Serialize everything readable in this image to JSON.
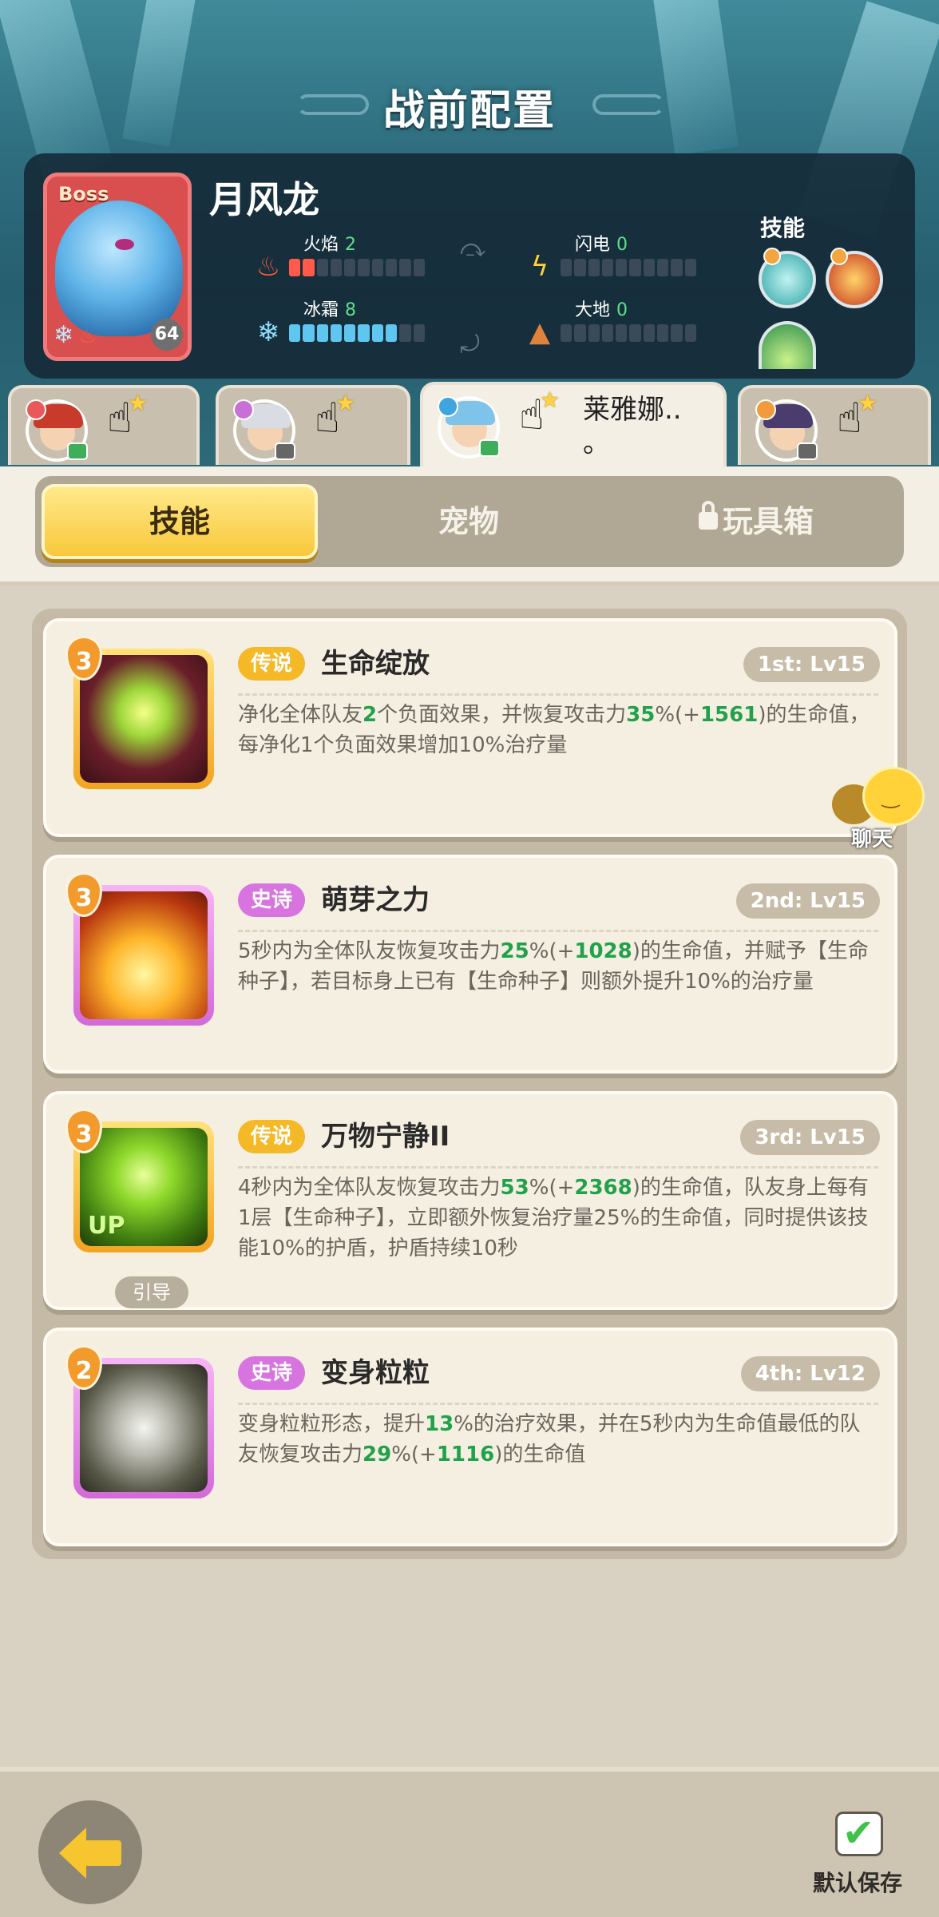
{
  "header": {
    "title": "战前配置"
  },
  "boss": {
    "tag": "Boss",
    "name": "月风龙",
    "level": "64",
    "stats": {
      "fire": {
        "label": "火焰",
        "value": "2",
        "level": 2,
        "max": 10
      },
      "lightning": {
        "label": "闪电",
        "value": "0",
        "level": 0,
        "max": 10
      },
      "frost": {
        "label": "冰霜",
        "value": "8",
        "level": 8,
        "max": 10
      },
      "earth": {
        "label": "大地",
        "value": "0",
        "level": 0,
        "max": 10
      }
    },
    "skills_label": "技能",
    "skill_icons": [
      "wind-vortex-icon",
      "fire-orb-icon",
      "green-leaf-icon"
    ]
  },
  "heroes": [
    {
      "name": "",
      "active": false,
      "hair_color": "#c83a2a",
      "element_color": "#e85a5a",
      "device_color": "#3fae5a"
    },
    {
      "name": "",
      "active": false,
      "hair_color": "#d9dde3",
      "element_color": "#c970d6",
      "device_color": "#666666"
    },
    {
      "name": "莱雅娜..\n。",
      "active": true,
      "hair_color": "#7ec3ea",
      "element_color": "#3ea5e0",
      "device_color": "#3fae5a"
    },
    {
      "name": "",
      "active": false,
      "hair_color": "#4b3c6e",
      "element_color": "#f39a3a",
      "device_color": "#666666"
    }
  ],
  "category_tabs": {
    "skills": "技能",
    "pets": "宠物",
    "toybox": "玩具箱",
    "active": "skills"
  },
  "skills": [
    {
      "rarity": "传说",
      "rarity_class": "legend",
      "name": "生命绽放",
      "slot": "1st: Lv15",
      "stars": "3",
      "desc_parts": [
        "净化全体队友",
        "2",
        "个负面效果，并恢复攻击力",
        "35",
        "%(+",
        "1561",
        ")的生命值，每净化1个负面效果增加10%治疗量"
      ]
    },
    {
      "rarity": "史诗",
      "rarity_class": "epic",
      "name": "萌芽之力",
      "slot": "2nd: Lv15",
      "stars": "3",
      "desc_parts": [
        "5秒内为全体队友恢复攻击力",
        "25",
        "%(+",
        "1028",
        ")的生命值，并赋予【生命种子】，若目标身上已有【生命种子】则额外提升10%的治疗量"
      ]
    },
    {
      "rarity": "传说",
      "rarity_class": "legend",
      "name": "万物宁静II",
      "slot": "3rd: Lv15",
      "stars": "3",
      "up": "UP",
      "guide": "引导",
      "desc_parts": [
        "4秒内为全体队友恢复攻击力",
        "53",
        "%(+",
        "2368",
        ")的生命值，队友身上每有1层【生命种子】，立即额外恢复治疗量25%的生命值，同时提供该技能10%的护盾，护盾持续10秒"
      ]
    },
    {
      "rarity": "史诗",
      "rarity_class": "epic",
      "name": "变身粒粒",
      "slot": "4th: Lv12",
      "stars": "2",
      "desc_parts": [
        "变身粒粒形态，提升",
        "13",
        "%的治疗效果，并在5秒内为生命值最低的队友恢复攻击力",
        "29",
        "%(+",
        "1116",
        ")的生命值"
      ]
    }
  ],
  "chat": {
    "label": "聊天"
  },
  "footer": {
    "save_label": "默认保存"
  }
}
